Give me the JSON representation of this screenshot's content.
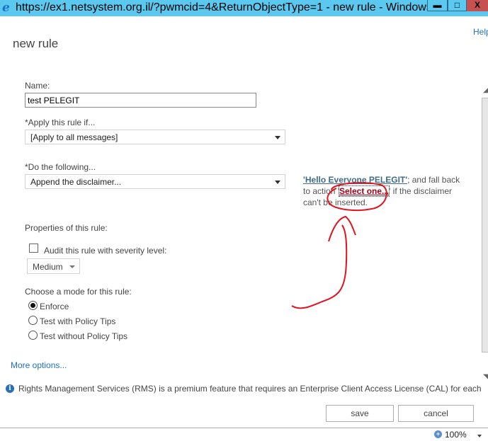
{
  "window": {
    "title": "https://ex1.netsystem.org.il/?pwmcid=4&ReturnObjectType=1 - new rule - Windows Int...",
    "minimize_glyph": "▬",
    "maximize_glyph": "□",
    "close_glyph": "X",
    "browser_icon": "e"
  },
  "page": {
    "title": "new rule",
    "help_label": "Help"
  },
  "form": {
    "name_label": "Name:",
    "name_value": "test PELEGIT",
    "apply_label": "*Apply this rule if...",
    "apply_value": "[Apply to all messages]",
    "do_label": "*Do the following...",
    "do_value": "Append the disclaimer...",
    "disclaimer_note": {
      "link_text": "'Hello Everyone PELEGIT'",
      "text_1": "; and fall back to action '",
      "select_link": "Select one...",
      "text_2": "' if the disclaimer can't be inserted."
    },
    "properties_label": "Properties of this rule:",
    "audit_label": "Audit this rule with severity level:",
    "audit_checked": false,
    "severity_value": "Medium",
    "mode_label": "Choose a mode for this rule:",
    "modes": [
      {
        "label": "Enforce",
        "checked": true
      },
      {
        "label": "Test with Policy Tips",
        "checked": false
      },
      {
        "label": "Test without Policy Tips",
        "checked": false
      }
    ],
    "more_options": "More options...",
    "info_text": "Rights Management Services (RMS) is a premium feature that requires an Enterprise Client Access License (CAL) for each"
  },
  "buttons": {
    "save": "save",
    "cancel": "cancel"
  },
  "statusbar": {
    "zoom_level": "100%"
  },
  "annotation": {
    "color": "#e0141e"
  }
}
